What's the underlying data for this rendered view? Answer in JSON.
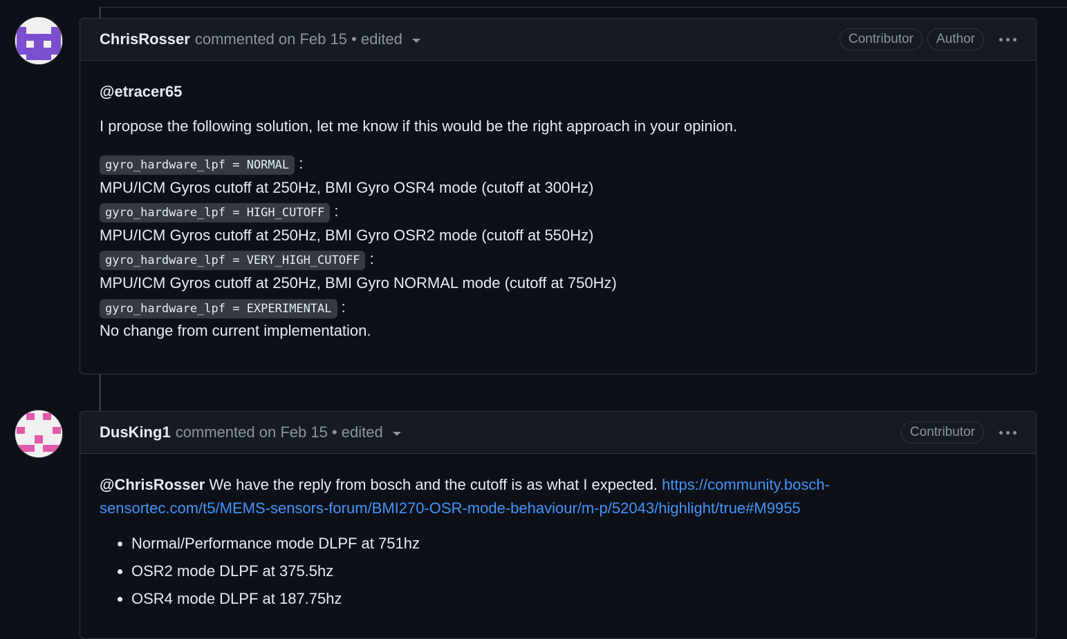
{
  "comments": [
    {
      "author": "ChrisRosser",
      "meta": "commented on Feb 15 • edited",
      "badges": [
        "Contributor",
        "Author"
      ],
      "mention": "@etracer65",
      "intro": "I propose the following solution, let me know if this would be the right approach in your opinion.",
      "options": [
        {
          "code": "gyro_hardware_lpf = NORMAL",
          "suffix": ":",
          "desc": "MPU/ICM Gyros cutoff at 250Hz, BMI Gyro OSR4 mode (cutoff at 300Hz)"
        },
        {
          "code": "gyro_hardware_lpf = HIGH_CUTOFF",
          "suffix": ":",
          "desc": "MPU/ICM Gyros cutoff at 250Hz, BMI Gyro OSR2 mode (cutoff at 550Hz)"
        },
        {
          "code": "gyro_hardware_lpf = VERY_HIGH_CUTOFF",
          "suffix": ":",
          "desc": "MPU/ICM Gyros cutoff at 250Hz, BMI Gyro NORMAL mode (cutoff at 750Hz)"
        },
        {
          "code": "gyro_hardware_lpf = EXPERIMENTAL",
          "suffix": ":",
          "desc": "No change from current implementation."
        }
      ]
    },
    {
      "author": "DusKing1",
      "meta": "commented on Feb 15 • edited",
      "badges": [
        "Contributor"
      ],
      "mention": "@ChrisRosser",
      "text": " We have the reply from bosch and the cutoff is as what I expected. ",
      "link_line1": "https://community.bosch-",
      "link_line2": "sensortec.com/t5/MEMS-sensors-forum/BMI270-OSR-mode-behaviour/m-p/52043/highlight/true#M9955",
      "bullets": [
        "Normal/Performance mode DLPF at 751hz",
        "OSR2 mode DLPF at 375.5hz",
        "OSR4 mode DLPF at 187.75hz"
      ]
    }
  ]
}
